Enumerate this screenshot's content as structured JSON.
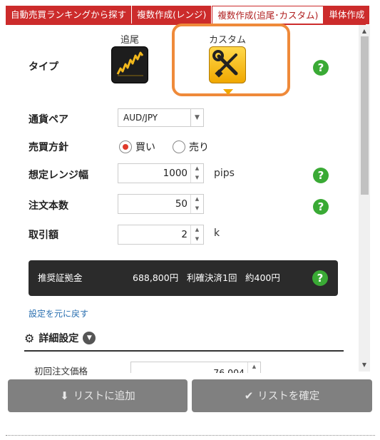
{
  "tabs": [
    {
      "label": "自動売買ランキングから探す"
    },
    {
      "label": "複数作成(レンジ)"
    },
    {
      "label": "複数作成(追尾･カスタム)"
    },
    {
      "label": "単体作成"
    }
  ],
  "type_row": {
    "label": "タイプ",
    "options": [
      {
        "caption": "追尾",
        "icon": "trail-chart-icon"
      },
      {
        "caption": "カスタム",
        "icon": "wrench-screwdriver-icon"
      }
    ]
  },
  "currency_pair": {
    "label": "通貨ペア",
    "value": "AUD/JPY"
  },
  "trade_direction": {
    "label": "売買方針",
    "options": [
      "買い",
      "売り"
    ],
    "selected": "買い"
  },
  "range_width": {
    "label": "想定レンジ幅",
    "value": "1000",
    "unit": "pips"
  },
  "order_count": {
    "label": "注文本数",
    "value": "50"
  },
  "trade_amount": {
    "label": "取引額",
    "value": "2",
    "unit": "k"
  },
  "summary": {
    "title": "推奨証拠金",
    "margin": "688,800円",
    "settle": "利確決済1回",
    "profit": "約400円"
  },
  "reset_link": "設定を元に戻す",
  "detail": {
    "title": "詳細設定",
    "first_price_label": "初回注文価格",
    "first_price_value": "76.004"
  },
  "buttons": {
    "add": "リストに追加",
    "confirm": "リストを確定"
  },
  "help_glyph": "?",
  "colors": {
    "tab_red": "#cc2b2b",
    "highlight_orange": "#ef8a3a",
    "help_green": "#3aaa35",
    "button_gray": "#808080"
  }
}
